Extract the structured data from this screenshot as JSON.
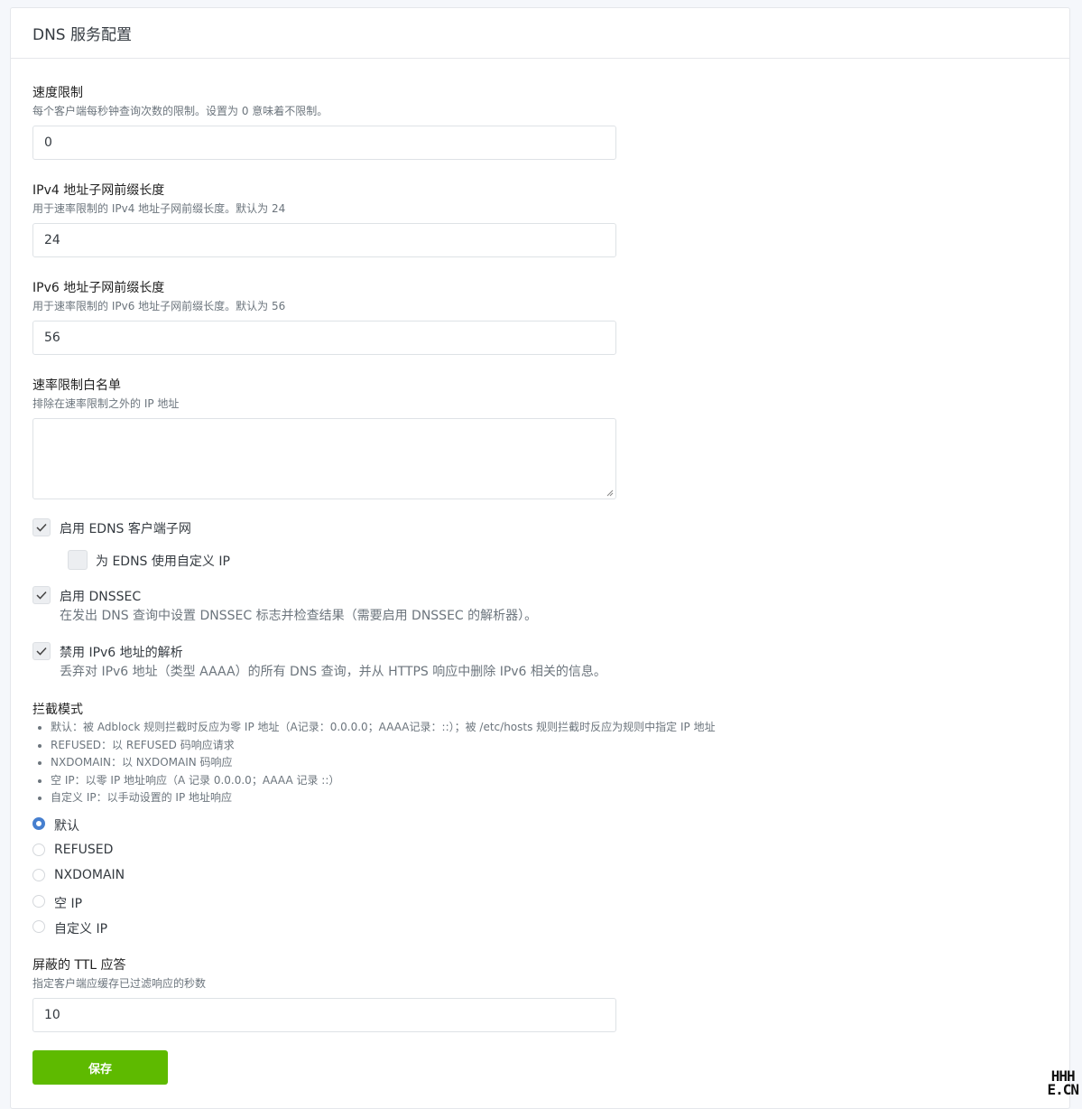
{
  "header": {
    "title": "DNS 服务配置"
  },
  "rate_limit": {
    "label": "速度限制",
    "desc": "每个客户端每秒钟查询次数的限制。设置为 0 意味着不限制。",
    "value": "0"
  },
  "ipv4_prefix": {
    "label": "IPv4 地址子网前缀长度",
    "desc": "用于速率限制的 IPv4 地址子网前缀长度。默认为 24",
    "value": "24"
  },
  "ipv6_prefix": {
    "label": "IPv6 地址子网前缀长度",
    "desc": "用于速率限制的 IPv6 地址子网前缀长度。默认为 56",
    "value": "56"
  },
  "whitelist": {
    "label": "速率限制白名单",
    "desc": "排除在速率限制之外的 IP 地址",
    "value": ""
  },
  "edns": {
    "label": "启用 EDNS 客户端子网",
    "checked": true
  },
  "edns_custom_ip": {
    "label": "为 EDNS 使用自定义 IP",
    "checked": false
  },
  "dnssec": {
    "label": "启用 DNSSEC",
    "desc": "在发出 DNS 查询中设置 DNSSEC 标志并检查结果（需要启用 DNSSEC 的解析器）。",
    "checked": true
  },
  "disable_ipv6": {
    "label": "禁用 IPv6 地址的解析",
    "desc": "丢弃对 IPv6 地址（类型 AAAA）的所有 DNS 查询，并从 HTTPS 响应中删除 IPv6 相关的信息。",
    "checked": true
  },
  "blocking_mode": {
    "label": "拦截模式",
    "rules": [
      "默认：被 Adblock 规则拦截时反应为零 IP 地址（A记录：0.0.0.0；AAAA记录：::）；被 /etc/hosts 规则拦截时反应为规则中指定 IP 地址",
      "REFUSED：以 REFUSED 码响应请求",
      "NXDOMAIN：以 NXDOMAIN 码响应",
      "空 IP：以零 IP 地址响应（A 记录 0.0.0.0；AAAA 记录 ::）",
      "自定义 IP：以手动设置的 IP 地址响应"
    ],
    "options": [
      "默认",
      "REFUSED",
      "NXDOMAIN",
      "空 IP",
      "自定义 IP"
    ],
    "selected": "默认"
  },
  "blocked_ttl": {
    "label": "屏蔽的 TTL 应答",
    "desc": "指定客户端应缓存已过滤响应的秒数",
    "value": "10"
  },
  "save_button": {
    "label": "保存",
    "color": "#5eba00"
  },
  "watermark": {
    "line1": "HHH",
    "line2": "E.CN"
  }
}
